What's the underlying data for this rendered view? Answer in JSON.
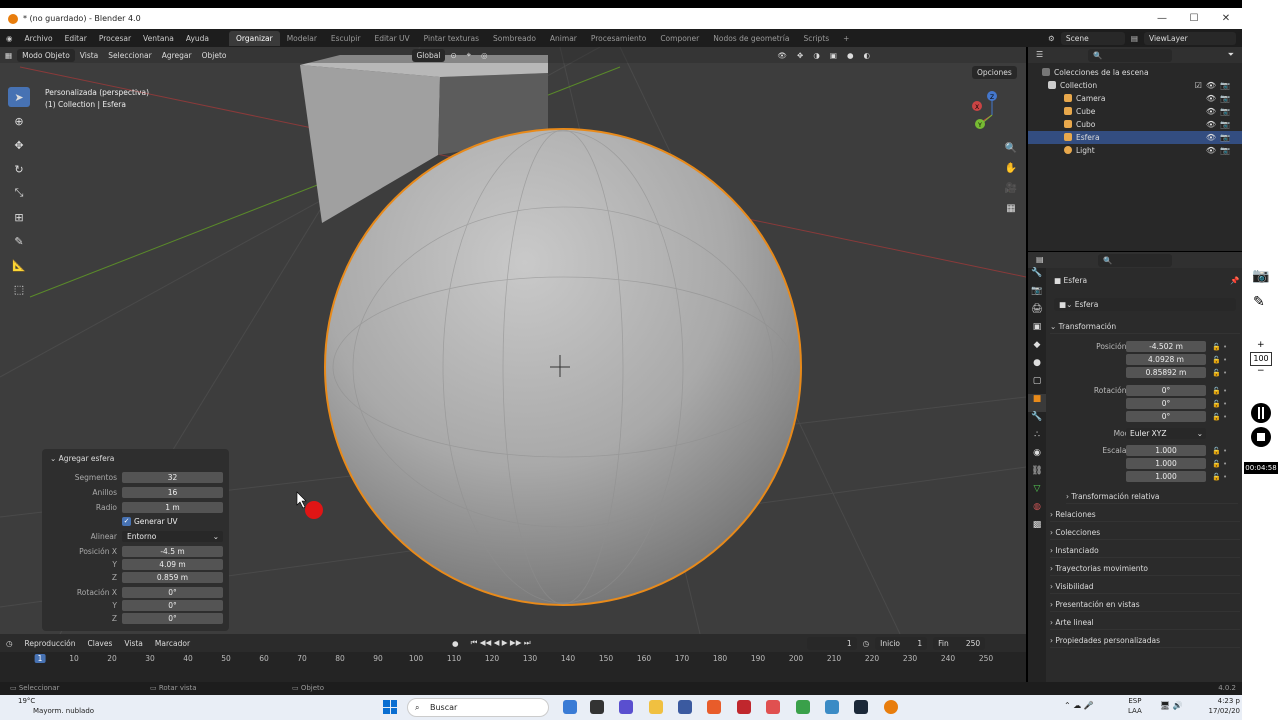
{
  "window": {
    "title": "* (no guardado) - Blender 4.0",
    "controls": [
      "—",
      "☐",
      "✕"
    ]
  },
  "menus": [
    "Archivo",
    "Editar",
    "Procesar",
    "Ventana",
    "Ayuda"
  ],
  "workspaces": [
    "Organizar",
    "Modelar",
    "Esculpir",
    "Editar UV",
    "Pintar texturas",
    "Sombreado",
    "Animar",
    "Procesamiento",
    "Componer",
    "Nodos de geometría",
    "Scripts",
    "+"
  ],
  "active_workspace": "Organizar",
  "scene": {
    "name": "Scene",
    "view_layer": "ViewLayer"
  },
  "viewport": {
    "mode": "Modo Objeto",
    "header_menus": [
      "Vista",
      "Seleccionar",
      "Agregar",
      "Objeto"
    ],
    "orientation": "Global",
    "options_label": "Opciones",
    "info_line1": "Personalizada (perspectiva)",
    "info_line2": "(1) Collection | Esfera",
    "gizmo_axes": [
      "X",
      "Y",
      "Z"
    ]
  },
  "operator_panel": {
    "title": "Agregar esfera",
    "rows": [
      {
        "label": "Segmentos",
        "value": "32"
      },
      {
        "label": "Anillos",
        "value": "16"
      },
      {
        "label": "Radio",
        "value": "1 m"
      }
    ],
    "generate_uv_label": "Generar UV",
    "align_label": "Alinear",
    "align_value": "Entorno",
    "position": [
      {
        "label": "Posición X",
        "value": "-4.5 m"
      },
      {
        "label": "Y",
        "value": "4.09 m"
      },
      {
        "label": "Z",
        "value": "0.859 m"
      }
    ],
    "rotation": [
      {
        "label": "Rotación X",
        "value": "0°"
      },
      {
        "label": "Y",
        "value": "0°"
      },
      {
        "label": "Z",
        "value": "0°"
      }
    ]
  },
  "timeline": {
    "menus": [
      "Reproducción",
      "Claves",
      "Vista",
      "Marcador"
    ],
    "current_frame": "1",
    "start_label": "Inicio",
    "start": "1",
    "end_label": "Fin",
    "end": "250",
    "ticks": [
      "1",
      "10",
      "20",
      "30",
      "40",
      "50",
      "60",
      "70",
      "80",
      "90",
      "100",
      "110",
      "120",
      "130",
      "140",
      "150",
      "160",
      "170",
      "180",
      "190",
      "200",
      "210",
      "220",
      "230",
      "240",
      "250"
    ]
  },
  "outliner": {
    "root": "Colecciones de la escena",
    "collection": "Collection",
    "items": [
      {
        "name": "Camera",
        "color": "#e8a84c",
        "selected": false
      },
      {
        "name": "Cube",
        "color": "#e8a84c",
        "selected": false
      },
      {
        "name": "Cubo",
        "color": "#e8a84c",
        "selected": false
      },
      {
        "name": "Esfera",
        "color": "#e8a84c",
        "selected": true
      },
      {
        "name": "Light",
        "color": "#e8a84c",
        "selected": false
      }
    ]
  },
  "properties": {
    "object_name": "Esfera",
    "object_field": "Esfera",
    "transform_label": "Transformación",
    "location": [
      {
        "label": "Posición X",
        "value": "-4.502 m"
      },
      {
        "label": "Y",
        "value": "4.0928 m"
      },
      {
        "label": "Z",
        "value": "0.85892 m"
      }
    ],
    "rotation": [
      {
        "label": "Rotación X",
        "value": "0°"
      },
      {
        "label": "Y",
        "value": "0°"
      },
      {
        "label": "Z",
        "value": "0°"
      }
    ],
    "mode_label": "Modo",
    "mode_value": "Euler XYZ",
    "scale": [
      {
        "label": "Escala X",
        "value": "1.000"
      },
      {
        "label": "Y",
        "value": "1.000"
      },
      {
        "label": "Z",
        "value": "1.000"
      }
    ],
    "delta_label": "Transformación relativa",
    "sections": [
      "Relaciones",
      "Colecciones",
      "Instanciado",
      "Trayectorias movimiento",
      "Visibilidad",
      "Presentación en vistas",
      "Arte lineal",
      "Propiedades personalizadas"
    ]
  },
  "statusbar": {
    "select": "Seleccionar",
    "rotate": "Rotar vista",
    "object": "Objeto",
    "version": "4.0.2"
  },
  "taskbar": {
    "weather_temp": "19°C",
    "weather": "Mayorm. nublado",
    "search": "Buscar",
    "lang": "ESP",
    "lang2": "LAA",
    "time": "4:23 p",
    "date": "17/02/20"
  },
  "recorder": {
    "zoom": "100",
    "timer": "00:04:58"
  },
  "colors": {
    "accent": "#4772b3",
    "selection_outline": "#e88a1a",
    "viewport_bg": "#3d3d3d"
  }
}
